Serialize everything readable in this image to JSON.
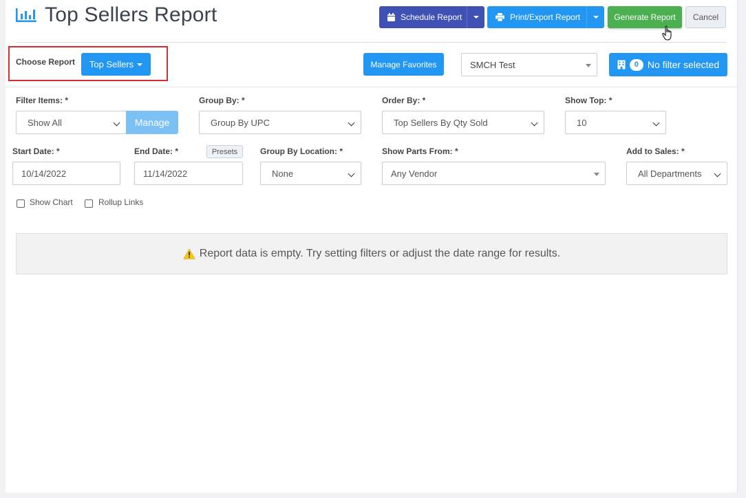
{
  "header": {
    "title": "Top Sellers Report",
    "schedule_label": "Schedule Report",
    "print_label": "Print/Export Report",
    "generate_label": "Generate Report",
    "cancel_label": "Cancel"
  },
  "toolbar": {
    "choose_report_label": "Choose Report",
    "report_selected": "Top Sellers",
    "manage_favorites_label": "Manage Favorites",
    "store_value": "SMCH Test",
    "filter_count": "0",
    "filter_label": "No filter selected"
  },
  "form": {
    "filter_items_label": "Filter Items: *",
    "filter_items_value": "Show All",
    "manage_label": "Manage",
    "group_by_label": "Group By: *",
    "group_by_value": "Group By UPC",
    "order_by_label": "Order By: *",
    "order_by_value": "Top Sellers By Qty Sold",
    "show_top_label": "Show Top: *",
    "show_top_value": "10",
    "start_date_label": "Start Date: *",
    "start_date_value": "10/14/2022",
    "end_date_label": "End Date: *",
    "presets_label": "Presets",
    "end_date_value": "11/14/2022",
    "group_by_location_label": "Group By Location: *",
    "group_by_location_value": "None",
    "show_parts_from_label": "Show Parts From: *",
    "show_parts_from_value": "Any Vendor",
    "add_to_sales_label": "Add to Sales: *",
    "add_to_sales_value": "All Departments",
    "show_chart_label": "Show Chart",
    "rollup_links_label": "Rollup Links"
  },
  "alert": {
    "message": "Report data is empty. Try setting filters or adjust the date range for results."
  },
  "colors": {
    "primary": "#2196f3",
    "indigo": "#3f51b5",
    "success": "#4caf50",
    "highlight": "#d32f2f",
    "warning": "#f5c518"
  },
  "icons": [
    "bar-chart-icon",
    "calendar-icon",
    "printer-icon",
    "cursor-hand-icon",
    "building-icon",
    "warning-icon"
  ]
}
